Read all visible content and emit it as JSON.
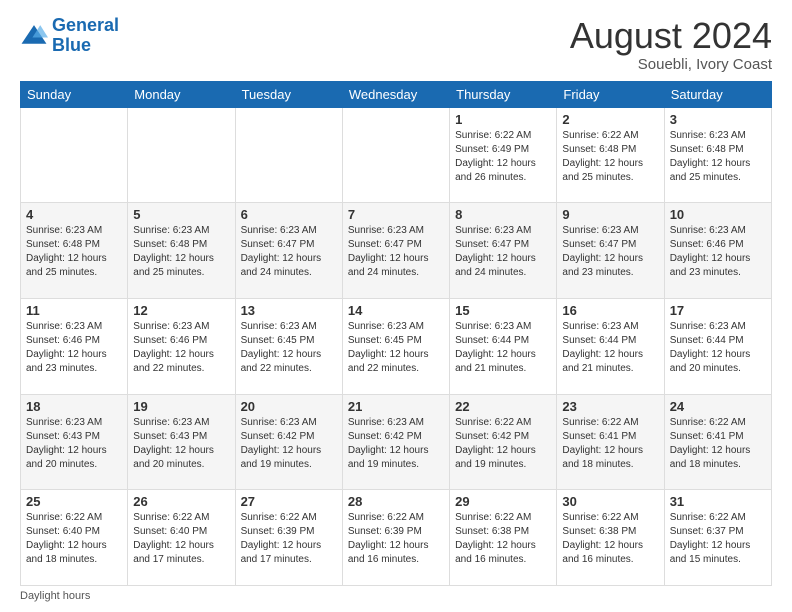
{
  "header": {
    "logo_line1": "General",
    "logo_line2": "Blue",
    "month_year": "August 2024",
    "location": "Souebli, Ivory Coast"
  },
  "days_of_week": [
    "Sunday",
    "Monday",
    "Tuesday",
    "Wednesday",
    "Thursday",
    "Friday",
    "Saturday"
  ],
  "weeks": [
    [
      {
        "day": "",
        "info": ""
      },
      {
        "day": "",
        "info": ""
      },
      {
        "day": "",
        "info": ""
      },
      {
        "day": "",
        "info": ""
      },
      {
        "day": "1",
        "info": "Sunrise: 6:22 AM\nSunset: 6:49 PM\nDaylight: 12 hours\nand 26 minutes."
      },
      {
        "day": "2",
        "info": "Sunrise: 6:22 AM\nSunset: 6:48 PM\nDaylight: 12 hours\nand 25 minutes."
      },
      {
        "day": "3",
        "info": "Sunrise: 6:23 AM\nSunset: 6:48 PM\nDaylight: 12 hours\nand 25 minutes."
      }
    ],
    [
      {
        "day": "4",
        "info": "Sunrise: 6:23 AM\nSunset: 6:48 PM\nDaylight: 12 hours\nand 25 minutes."
      },
      {
        "day": "5",
        "info": "Sunrise: 6:23 AM\nSunset: 6:48 PM\nDaylight: 12 hours\nand 25 minutes."
      },
      {
        "day": "6",
        "info": "Sunrise: 6:23 AM\nSunset: 6:47 PM\nDaylight: 12 hours\nand 24 minutes."
      },
      {
        "day": "7",
        "info": "Sunrise: 6:23 AM\nSunset: 6:47 PM\nDaylight: 12 hours\nand 24 minutes."
      },
      {
        "day": "8",
        "info": "Sunrise: 6:23 AM\nSunset: 6:47 PM\nDaylight: 12 hours\nand 24 minutes."
      },
      {
        "day": "9",
        "info": "Sunrise: 6:23 AM\nSunset: 6:47 PM\nDaylight: 12 hours\nand 23 minutes."
      },
      {
        "day": "10",
        "info": "Sunrise: 6:23 AM\nSunset: 6:46 PM\nDaylight: 12 hours\nand 23 minutes."
      }
    ],
    [
      {
        "day": "11",
        "info": "Sunrise: 6:23 AM\nSunset: 6:46 PM\nDaylight: 12 hours\nand 23 minutes."
      },
      {
        "day": "12",
        "info": "Sunrise: 6:23 AM\nSunset: 6:46 PM\nDaylight: 12 hours\nand 22 minutes."
      },
      {
        "day": "13",
        "info": "Sunrise: 6:23 AM\nSunset: 6:45 PM\nDaylight: 12 hours\nand 22 minutes."
      },
      {
        "day": "14",
        "info": "Sunrise: 6:23 AM\nSunset: 6:45 PM\nDaylight: 12 hours\nand 22 minutes."
      },
      {
        "day": "15",
        "info": "Sunrise: 6:23 AM\nSunset: 6:44 PM\nDaylight: 12 hours\nand 21 minutes."
      },
      {
        "day": "16",
        "info": "Sunrise: 6:23 AM\nSunset: 6:44 PM\nDaylight: 12 hours\nand 21 minutes."
      },
      {
        "day": "17",
        "info": "Sunrise: 6:23 AM\nSunset: 6:44 PM\nDaylight: 12 hours\nand 20 minutes."
      }
    ],
    [
      {
        "day": "18",
        "info": "Sunrise: 6:23 AM\nSunset: 6:43 PM\nDaylight: 12 hours\nand 20 minutes."
      },
      {
        "day": "19",
        "info": "Sunrise: 6:23 AM\nSunset: 6:43 PM\nDaylight: 12 hours\nand 20 minutes."
      },
      {
        "day": "20",
        "info": "Sunrise: 6:23 AM\nSunset: 6:42 PM\nDaylight: 12 hours\nand 19 minutes."
      },
      {
        "day": "21",
        "info": "Sunrise: 6:23 AM\nSunset: 6:42 PM\nDaylight: 12 hours\nand 19 minutes."
      },
      {
        "day": "22",
        "info": "Sunrise: 6:22 AM\nSunset: 6:42 PM\nDaylight: 12 hours\nand 19 minutes."
      },
      {
        "day": "23",
        "info": "Sunrise: 6:22 AM\nSunset: 6:41 PM\nDaylight: 12 hours\nand 18 minutes."
      },
      {
        "day": "24",
        "info": "Sunrise: 6:22 AM\nSunset: 6:41 PM\nDaylight: 12 hours\nand 18 minutes."
      }
    ],
    [
      {
        "day": "25",
        "info": "Sunrise: 6:22 AM\nSunset: 6:40 PM\nDaylight: 12 hours\nand 18 minutes."
      },
      {
        "day": "26",
        "info": "Sunrise: 6:22 AM\nSunset: 6:40 PM\nDaylight: 12 hours\nand 17 minutes."
      },
      {
        "day": "27",
        "info": "Sunrise: 6:22 AM\nSunset: 6:39 PM\nDaylight: 12 hours\nand 17 minutes."
      },
      {
        "day": "28",
        "info": "Sunrise: 6:22 AM\nSunset: 6:39 PM\nDaylight: 12 hours\nand 16 minutes."
      },
      {
        "day": "29",
        "info": "Sunrise: 6:22 AM\nSunset: 6:38 PM\nDaylight: 12 hours\nand 16 minutes."
      },
      {
        "day": "30",
        "info": "Sunrise: 6:22 AM\nSunset: 6:38 PM\nDaylight: 12 hours\nand 16 minutes."
      },
      {
        "day": "31",
        "info": "Sunrise: 6:22 AM\nSunset: 6:37 PM\nDaylight: 12 hours\nand 15 minutes."
      }
    ]
  ],
  "footer": {
    "note": "Daylight hours"
  },
  "colors": {
    "header_bg": "#1a6ab1",
    "logo_blue": "#1a6ab1"
  }
}
